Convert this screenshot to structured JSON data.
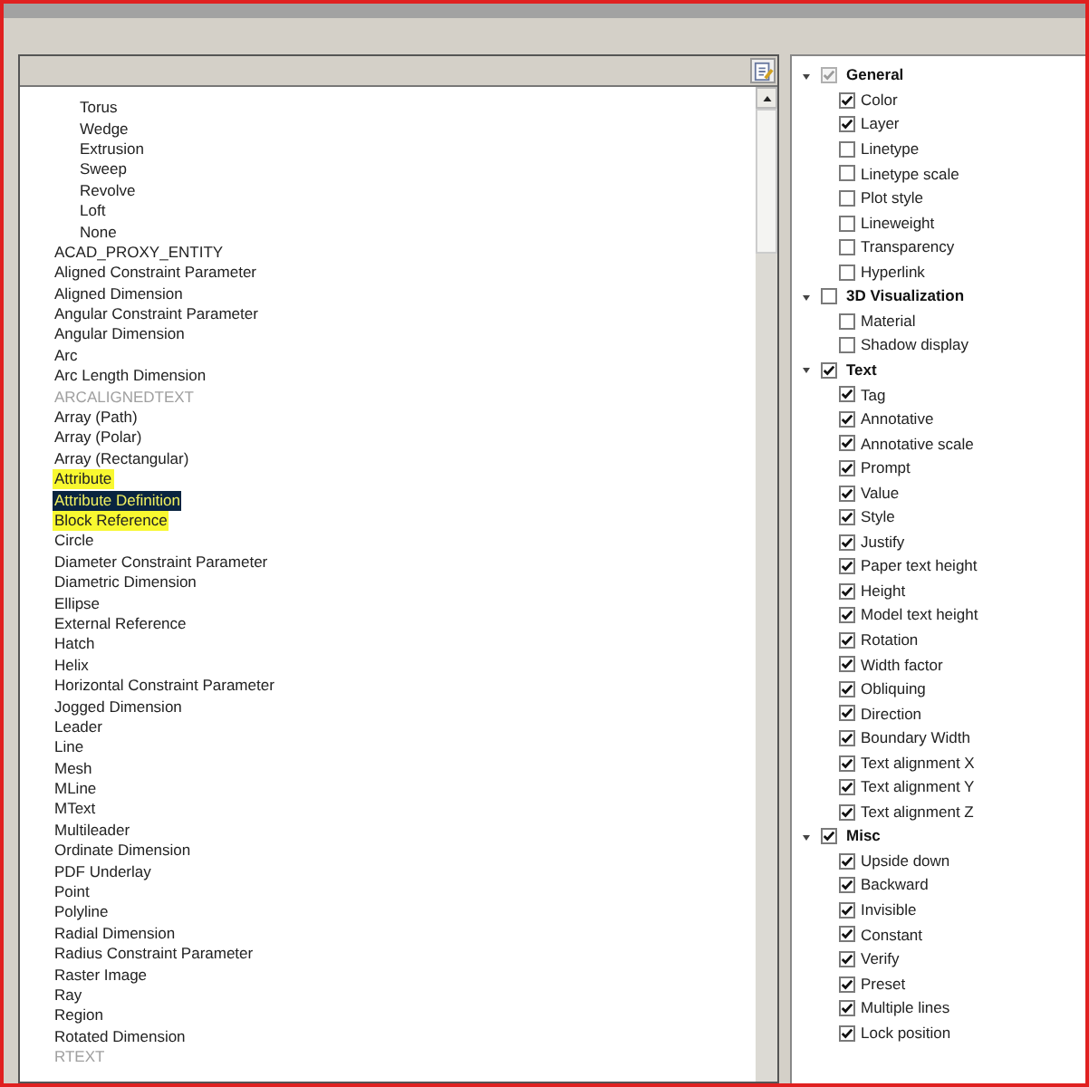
{
  "entity_list": [
    {
      "children": [
        {
          "label": "Torus",
          "selected": false,
          "disabled": false,
          "highlighted": false
        },
        {
          "label": "Wedge",
          "selected": false,
          "disabled": false,
          "highlighted": false
        },
        {
          "label": "Extrusion",
          "selected": false,
          "disabled": false,
          "highlighted": false
        },
        {
          "label": "Sweep",
          "selected": false,
          "disabled": false,
          "highlighted": false
        },
        {
          "label": "Revolve",
          "selected": false,
          "disabled": false,
          "highlighted": false
        },
        {
          "label": "Loft",
          "selected": false,
          "disabled": false,
          "highlighted": false
        },
        {
          "label": "None",
          "selected": false,
          "disabled": false,
          "highlighted": false
        }
      ]
    },
    {
      "label": "ACAD_PROXY_ENTITY",
      "selected": false,
      "disabled": false,
      "highlighted": false
    },
    {
      "label": "Aligned Constraint Parameter",
      "selected": false,
      "disabled": false,
      "highlighted": false
    },
    {
      "label": "Aligned Dimension",
      "selected": false,
      "disabled": false,
      "highlighted": false
    },
    {
      "label": "Angular Constraint Parameter",
      "selected": false,
      "disabled": false,
      "highlighted": false
    },
    {
      "label": "Angular Dimension",
      "selected": false,
      "disabled": false,
      "highlighted": false
    },
    {
      "label": "Arc",
      "selected": false,
      "disabled": false,
      "highlighted": false
    },
    {
      "label": "Arc Length Dimension",
      "selected": false,
      "disabled": false,
      "highlighted": false
    },
    {
      "label": "ARCALIGNEDTEXT",
      "selected": false,
      "disabled": true,
      "highlighted": false
    },
    {
      "label": "Array (Path)",
      "selected": false,
      "disabled": false,
      "highlighted": false
    },
    {
      "label": "Array (Polar)",
      "selected": false,
      "disabled": false,
      "highlighted": false
    },
    {
      "label": "Array (Rectangular)",
      "selected": false,
      "disabled": false,
      "highlighted": false
    },
    {
      "label": "Attribute",
      "selected": false,
      "disabled": false,
      "highlighted": true
    },
    {
      "label": "Attribute Definition",
      "selected": true,
      "disabled": false,
      "highlighted": true
    },
    {
      "label": "Block Reference",
      "selected": false,
      "disabled": false,
      "highlighted": true
    },
    {
      "label": "Circle",
      "selected": false,
      "disabled": false,
      "highlighted": false
    },
    {
      "label": "Diameter Constraint Parameter",
      "selected": false,
      "disabled": false,
      "highlighted": false
    },
    {
      "label": "Diametric Dimension",
      "selected": false,
      "disabled": false,
      "highlighted": false
    },
    {
      "label": "Ellipse",
      "selected": false,
      "disabled": false,
      "highlighted": false
    },
    {
      "label": "External Reference",
      "selected": false,
      "disabled": false,
      "highlighted": false
    },
    {
      "label": "Hatch",
      "selected": false,
      "disabled": false,
      "highlighted": false
    },
    {
      "label": "Helix",
      "selected": false,
      "disabled": false,
      "highlighted": false
    },
    {
      "label": "Horizontal Constraint Parameter",
      "selected": false,
      "disabled": false,
      "highlighted": false
    },
    {
      "label": "Jogged Dimension",
      "selected": false,
      "disabled": false,
      "highlighted": false
    },
    {
      "label": "Leader",
      "selected": false,
      "disabled": false,
      "highlighted": false
    },
    {
      "label": "Line",
      "selected": false,
      "disabled": false,
      "highlighted": false
    },
    {
      "label": "Mesh",
      "selected": false,
      "disabled": false,
      "highlighted": false
    },
    {
      "label": "MLine",
      "selected": false,
      "disabled": false,
      "highlighted": false
    },
    {
      "label": "MText",
      "selected": false,
      "disabled": false,
      "highlighted": false
    },
    {
      "label": "Multileader",
      "selected": false,
      "disabled": false,
      "highlighted": false
    },
    {
      "label": "Ordinate Dimension",
      "selected": false,
      "disabled": false,
      "highlighted": false
    },
    {
      "label": "PDF Underlay",
      "selected": false,
      "disabled": false,
      "highlighted": false
    },
    {
      "label": "Point",
      "selected": false,
      "disabled": false,
      "highlighted": false
    },
    {
      "label": "Polyline",
      "selected": false,
      "disabled": false,
      "highlighted": false
    },
    {
      "label": "Radial Dimension",
      "selected": false,
      "disabled": false,
      "highlighted": false
    },
    {
      "label": "Radius Constraint Parameter",
      "selected": false,
      "disabled": false,
      "highlighted": false
    },
    {
      "label": "Raster Image",
      "selected": false,
      "disabled": false,
      "highlighted": false
    },
    {
      "label": "Ray",
      "selected": false,
      "disabled": false,
      "highlighted": false
    },
    {
      "label": "Region",
      "selected": false,
      "disabled": false,
      "highlighted": false
    },
    {
      "label": "Rotated Dimension",
      "selected": false,
      "disabled": false,
      "highlighted": false
    },
    {
      "label": "RTEXT",
      "selected": false,
      "disabled": true,
      "highlighted": false
    }
  ],
  "property_tree": [
    {
      "label": "General",
      "expanded": true,
      "checked": true,
      "partial": true,
      "children": [
        {
          "label": "Color",
          "checked": true
        },
        {
          "label": "Layer",
          "checked": true
        },
        {
          "label": "Linetype",
          "checked": false
        },
        {
          "label": "Linetype scale",
          "checked": false
        },
        {
          "label": "Plot style",
          "checked": false
        },
        {
          "label": "Lineweight",
          "checked": false
        },
        {
          "label": "Transparency",
          "checked": false
        },
        {
          "label": "Hyperlink",
          "checked": false
        }
      ]
    },
    {
      "label": "3D Visualization",
      "expanded": true,
      "checked": false,
      "children": [
        {
          "label": "Material",
          "checked": false
        },
        {
          "label": "Shadow display",
          "checked": false
        }
      ]
    },
    {
      "label": "Text",
      "expanded": true,
      "checked": true,
      "children": [
        {
          "label": "Tag",
          "checked": true
        },
        {
          "label": "Annotative",
          "checked": true
        },
        {
          "label": "Annotative scale",
          "checked": true
        },
        {
          "label": "Prompt",
          "checked": true
        },
        {
          "label": "Value",
          "checked": true
        },
        {
          "label": "Style",
          "checked": true
        },
        {
          "label": "Justify",
          "checked": true
        },
        {
          "label": "Paper text height",
          "checked": true
        },
        {
          "label": "Height",
          "checked": true
        },
        {
          "label": "Model text height",
          "checked": true
        },
        {
          "label": "Rotation",
          "checked": true
        },
        {
          "label": "Width factor",
          "checked": true
        },
        {
          "label": "Obliquing",
          "checked": true
        },
        {
          "label": "Direction",
          "checked": true
        },
        {
          "label": "Boundary Width",
          "checked": true
        },
        {
          "label": "Text alignment X",
          "checked": true
        },
        {
          "label": "Text alignment Y",
          "checked": true
        },
        {
          "label": "Text alignment Z",
          "checked": true
        }
      ]
    },
    {
      "label": "Misc",
      "expanded": true,
      "checked": true,
      "children": [
        {
          "label": "Upside down",
          "checked": true
        },
        {
          "label": "Backward",
          "checked": true
        },
        {
          "label": "Invisible",
          "checked": true
        },
        {
          "label": "Constant",
          "checked": true
        },
        {
          "label": "Verify",
          "checked": true
        },
        {
          "label": "Preset",
          "checked": true
        },
        {
          "label": "Multiple lines",
          "checked": true
        },
        {
          "label": "Lock position",
          "checked": true
        }
      ]
    }
  ]
}
